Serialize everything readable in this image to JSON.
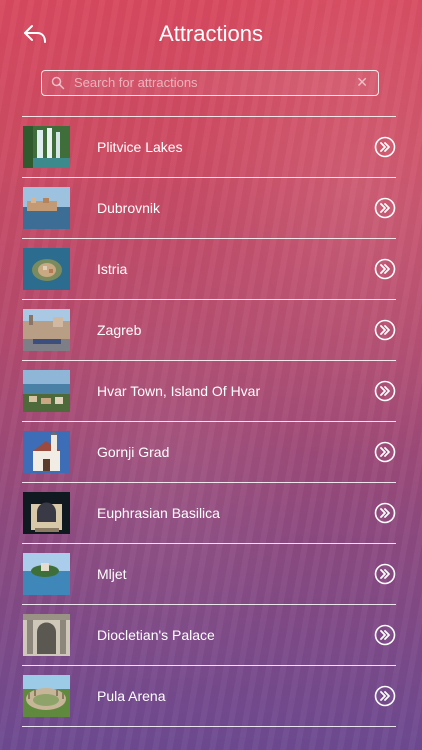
{
  "header": {
    "title": "Attractions",
    "back_icon": "back-arrow-icon"
  },
  "search": {
    "placeholder": "Search for attractions",
    "value": "",
    "icon": "search-icon",
    "clear_icon": "close-icon",
    "clear_glyph": "✕"
  },
  "colors": {
    "gradient_top": "#d8495f",
    "gradient_bottom": "#6d4a92",
    "text": "#ffffff",
    "divider": "#ffffff"
  },
  "attractions": [
    {
      "label": "Plitvice Lakes",
      "thumb_icon": "waterfall-photo"
    },
    {
      "label": "Dubrovnik",
      "thumb_icon": "coastal-town-photo"
    },
    {
      "label": "Istria",
      "thumb_icon": "island-aerial-photo"
    },
    {
      "label": "Zagreb",
      "thumb_icon": "city-square-photo"
    },
    {
      "label": "Hvar Town, Island Of Hvar",
      "thumb_icon": "harbor-view-photo"
    },
    {
      "label": "Gornji Grad",
      "thumb_icon": "church-photo"
    },
    {
      "label": "Euphrasian Basilica",
      "thumb_icon": "basilica-photo"
    },
    {
      "label": "Mljet",
      "thumb_icon": "lake-island-photo"
    },
    {
      "label": "Diocletian's Palace",
      "thumb_icon": "palace-ruins-photo"
    },
    {
      "label": "Pula Arena",
      "thumb_icon": "amphitheater-photo"
    }
  ],
  "row_action_icon": "double-chevron-right-icon"
}
